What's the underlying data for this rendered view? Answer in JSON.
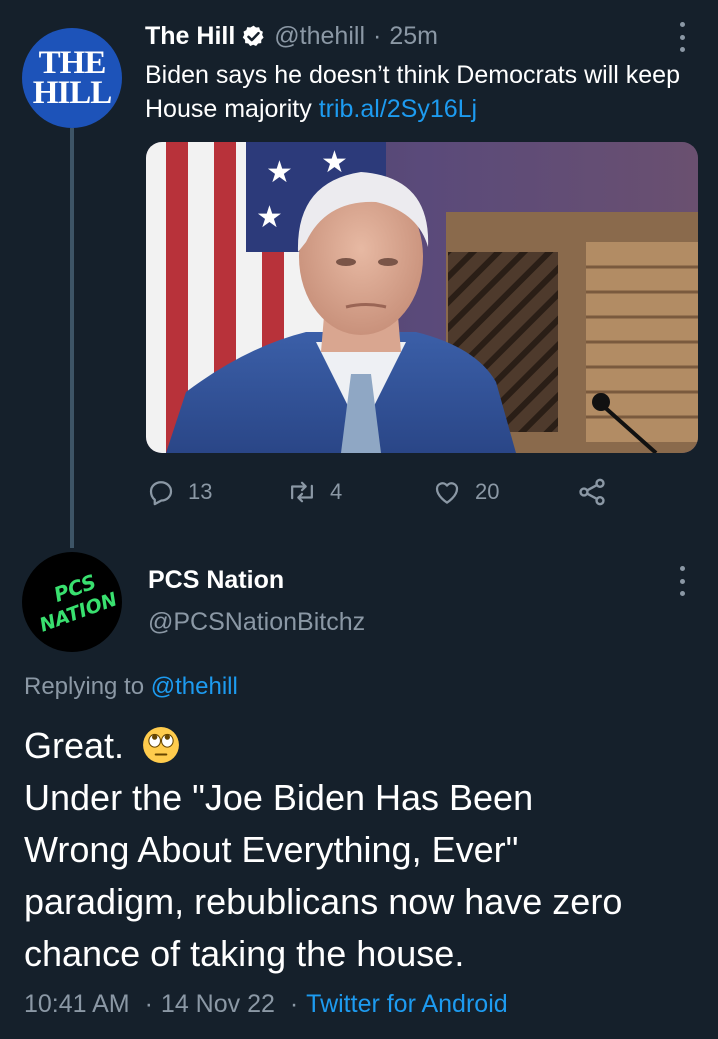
{
  "parent_tweet": {
    "avatar_text": [
      "THE",
      "HILL"
    ],
    "display_name": "The Hill",
    "handle": "@thehill",
    "separator": "·",
    "time": "25m",
    "text": "Biden says he doesn’t think Democrats will keep House majority",
    "link": "trib.al/2Sy16Lj",
    "image_icon": "photo-of-man-in-suit-before-flag",
    "actions": {
      "replies": "13",
      "retweets": "4",
      "likes": "20"
    }
  },
  "reply_tweet": {
    "avatar_text": [
      "PCS",
      "NATION"
    ],
    "display_name": "PCS Nation",
    "handle": "@PCSNationBitchz",
    "replying_prefix": "Replying to",
    "replying_handle": "@thehill",
    "lines": [
      "Great.",
      "Under the \"Joe Biden Has Been",
      "Wrong About Everything, Ever\"",
      "paradigm, rebublicans now have zero",
      "chance of taking the house."
    ],
    "emoji_icon": "face-with-rolling-eyes",
    "time": "10:41 AM",
    "separator": "·",
    "date": "14 Nov 22",
    "client": "Twitter for Android"
  },
  "colors": {
    "background": "#15202b",
    "text": "#ffffff",
    "muted": "#8b98a5",
    "link": "#1d9bf0",
    "hill_avatar": "#1d53b9",
    "pcs_green": "#39e06f"
  }
}
